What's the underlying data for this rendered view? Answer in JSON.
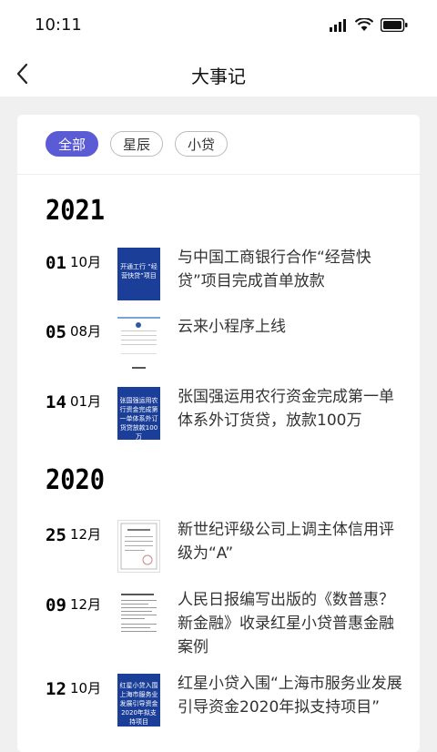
{
  "status": {
    "time": "10:11"
  },
  "nav": {
    "title": "大事记"
  },
  "filters": [
    "全部",
    "星辰",
    "小贷"
  ],
  "years": [
    "2021",
    "2020"
  ],
  "events2021": [
    {
      "day": "01",
      "month": "10月",
      "desc": "与中国工商银行合作“经营快贷”项目完成首单放款",
      "thumb": "blue",
      "thumb_text": "开通工行 “经营快贷”项目"
    },
    {
      "day": "05",
      "month": "08月",
      "desc": "云来小程序上线",
      "thumb": "app"
    },
    {
      "day": "14",
      "month": "01月",
      "desc": "张国强运用农行资金完成第一单体系外订货贷，放款100万",
      "thumb": "blue",
      "thumb_text": "张国强运用农行资金完成第一单体系外订货贷放款100万"
    }
  ],
  "events2020": [
    {
      "day": "25",
      "month": "12月",
      "desc": "新世纪评级公司上调主体信用评级为“A”",
      "thumb": "doc"
    },
    {
      "day": "09",
      "month": "12月",
      "desc": "人民日报编写出版的《数普惠？新金融》收录红星小贷普惠金融案例",
      "thumb": "doc"
    },
    {
      "day": "12",
      "month": "10月",
      "desc": "红星小贷入围“上海市服务业发展引导资金2020年拟支持项目”",
      "thumb": "blue",
      "thumb_text": "红星小贷入围 上海市服务业发展引导资金 2020年拟支持项目"
    }
  ]
}
